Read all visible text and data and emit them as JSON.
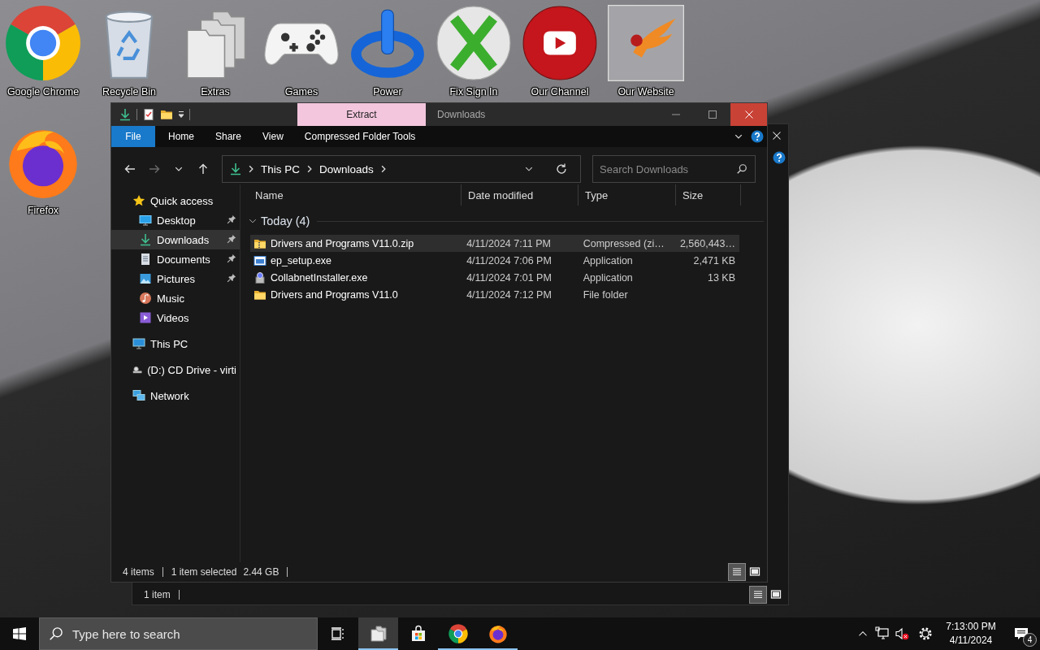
{
  "desktop_icons": [
    {
      "label": "Google Chrome",
      "kind": "chrome",
      "highlighted": false
    },
    {
      "label": "Recycle Bin",
      "kind": "bin",
      "highlighted": false
    },
    {
      "label": "Extras",
      "kind": "folders",
      "highlighted": false
    },
    {
      "label": "Games",
      "kind": "controller",
      "highlighted": false
    },
    {
      "label": "Power",
      "kind": "power",
      "highlighted": false
    },
    {
      "label": "Fix Sign In",
      "kind": "xball",
      "highlighted": false
    },
    {
      "label": "Our Channel",
      "kind": "play",
      "highlighted": false
    },
    {
      "label": "Our Website",
      "kind": "bird",
      "highlighted": true
    },
    {
      "label": "Firefox",
      "kind": "firefox",
      "highlighted": false
    }
  ],
  "back_window": {
    "status_bar": {
      "item_count": "1 item"
    },
    "views": [
      {
        "kind": "details",
        "selected": true
      },
      {
        "kind": "large_icons",
        "selected": false
      }
    ]
  },
  "window": {
    "title": "Downloads",
    "context_tab": "Extract",
    "close_hovered": true,
    "forward_disabled": true,
    "ribbon_tabs": [
      {
        "label": "File",
        "kind": "file"
      },
      {
        "label": "Home",
        "kind": "tab"
      },
      {
        "label": "Share",
        "kind": "tab"
      },
      {
        "label": "View",
        "kind": "tab"
      },
      {
        "label": "Compressed Folder Tools",
        "kind": "tab"
      }
    ],
    "address": [
      "This PC",
      "Downloads"
    ],
    "search": {
      "placeholder": "Search Downloads"
    },
    "nav_pane": [
      {
        "label": "Quick access",
        "kind": "star",
        "selected": false,
        "pinned": false,
        "children": [
          {
            "label": "Desktop",
            "kind": "desktop",
            "selected": false,
            "pinned": true
          },
          {
            "label": "Downloads",
            "kind": "download",
            "selected": true,
            "pinned": true
          },
          {
            "label": "Documents",
            "kind": "documents",
            "selected": false,
            "pinned": true
          },
          {
            "label": "Pictures",
            "kind": "pictures",
            "selected": false,
            "pinned": true
          },
          {
            "label": "Music",
            "kind": "music",
            "selected": false,
            "pinned": false
          },
          {
            "label": "Videos",
            "kind": "videos",
            "selected": false,
            "pinned": false
          }
        ]
      },
      {
        "label": "This PC",
        "kind": "pc",
        "selected": false,
        "pinned": false
      },
      {
        "label": "(D:) CD Drive - virti",
        "kind": "cd",
        "selected": false,
        "pinned": false
      },
      {
        "label": "Network",
        "kind": "network",
        "selected": false,
        "pinned": false
      }
    ],
    "columns": [
      "Name",
      "Date modified",
      "Type",
      "Size"
    ],
    "group": "Today (4)",
    "files": [
      {
        "name": "Drivers and Programs V11.0.zip",
        "kind": "zip",
        "date": "4/11/2024 7:11 PM",
        "type": "Compressed (zi…",
        "size": "2,560,443…",
        "selected": true
      },
      {
        "name": "ep_setup.exe",
        "kind": "app",
        "date": "4/11/2024 7:06 PM",
        "type": "Application",
        "size": "2,471 KB",
        "selected": false
      },
      {
        "name": "CollabnetInstaller.exe",
        "kind": "installer",
        "date": "4/11/2024 7:01 PM",
        "type": "Application",
        "size": "13 KB",
        "selected": false
      },
      {
        "name": "Drivers and Programs V11.0",
        "kind": "folder",
        "date": "4/11/2024 7:12 PM",
        "type": "File folder",
        "selected": false
      }
    ],
    "status_bar": {
      "item_count": "4 items",
      "selection": "1 item selected",
      "selection_size": "2.44 GB"
    },
    "views": [
      {
        "kind": "details",
        "selected": true
      },
      {
        "kind": "large_icons",
        "selected": false
      }
    ]
  },
  "taskbar": {
    "search": {
      "placeholder": "Type here to search"
    },
    "apps": [
      {
        "kind": "explorer",
        "running": true,
        "active": true
      },
      {
        "kind": "store",
        "running": false,
        "active": false
      },
      {
        "kind": "chrome",
        "running": true,
        "active": false
      },
      {
        "kind": "firefox",
        "running": true,
        "active": false
      }
    ],
    "volume_muted": true,
    "time": "7:13:00 PM",
    "date": "4/11/2024",
    "notification_count": "4"
  }
}
